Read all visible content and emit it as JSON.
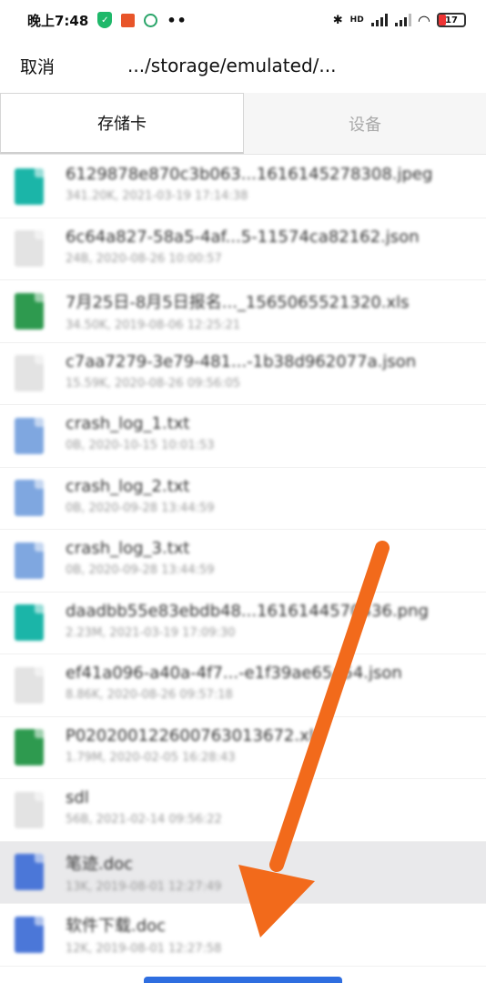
{
  "status_bar": {
    "time": "晚上7:48",
    "dots": "••",
    "hd_label": "HD",
    "battery": "17"
  },
  "header": {
    "cancel_label": "取消",
    "path": ".../storage/emulated/..."
  },
  "tabs": [
    {
      "label": "存储卡",
      "active": true
    },
    {
      "label": "设备",
      "active": false
    }
  ],
  "files": [
    {
      "name": "6129878e870c3b063...1616145278308.jpeg",
      "meta": "341.20K, 2021-03-19 17:14:38",
      "type": "img"
    },
    {
      "name": "6c64a827-58a5-4af...5-11574ca82162.json",
      "meta": "24B, 2020-08-26 10:00:57",
      "type": "unknown"
    },
    {
      "name": "7月25日-8月5日报名..._1565065521320.xls",
      "meta": "34.50K, 2019-08-06 12:25:21",
      "type": "xls"
    },
    {
      "name": "c7aa7279-3e79-481...-1b38d962077a.json",
      "meta": "15.59K, 2020-08-26 09:56:05",
      "type": "unknown"
    },
    {
      "name": "crash_log_1.txt",
      "meta": "0B, 2020-10-15 10:01:53",
      "type": "txt"
    },
    {
      "name": "crash_log_2.txt",
      "meta": "0B, 2020-09-28 13:44:59",
      "type": "txt"
    },
    {
      "name": "crash_log_3.txt",
      "meta": "0B, 2020-09-28 13:44:59",
      "type": "txt"
    },
    {
      "name": "daadbb55e83ebdb48...1616144570436.png",
      "meta": "2.23M, 2021-03-19 17:09:30",
      "type": "img"
    },
    {
      "name": "ef41a096-a40a-4f7...-e1f39ae65a54.json",
      "meta": "8.86K, 2020-08-26 09:57:18",
      "type": "unknown"
    },
    {
      "name": "P020200122600763013672.xls",
      "meta": "1.79M, 2020-02-05 16:28:43",
      "type": "xls"
    },
    {
      "name": "sdl",
      "meta": "56B, 2021-02-14 09:56:22",
      "type": "unknown"
    },
    {
      "name": "笔迹.doc",
      "meta": "13K, 2019-08-01 12:27:49",
      "type": "doc",
      "selected": true
    },
    {
      "name": "软件下载.doc",
      "meta": "12K, 2019-08-01 12:27:58",
      "type": "doc"
    }
  ],
  "colors": {
    "arrow": "#f26a1b",
    "accent": "#2f6ee0"
  }
}
